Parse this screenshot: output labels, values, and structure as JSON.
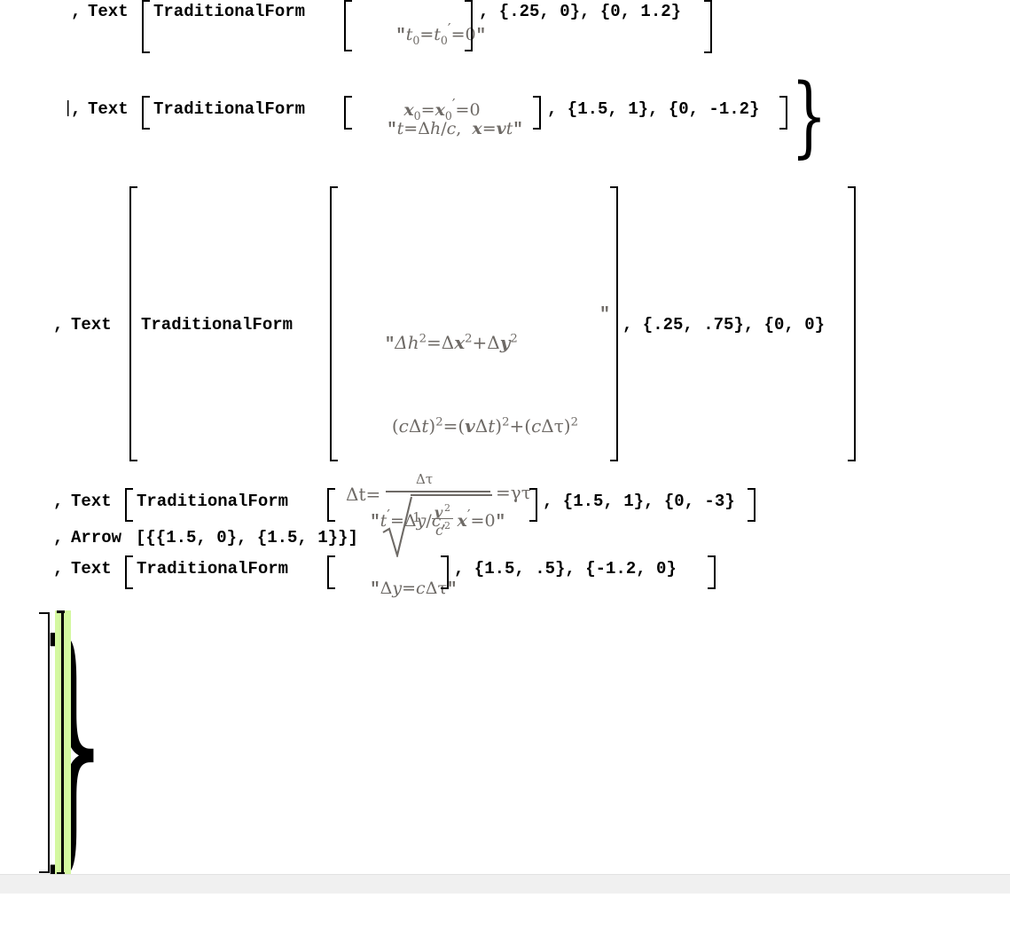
{
  "notebook": {
    "background": "#ffffff",
    "code_color": "#000000",
    "string_color": "#6e6a66",
    "cell_bracket_highlight": "#d4f8a0",
    "chrome_color": "#f0f0f0"
  },
  "line1": {
    "comma": ", ",
    "head": "Text",
    "inner_head": "TraditionalForm",
    "string_line_a_parts": {
      "t": "t",
      "sub0": "0",
      "eq": "=",
      "t2": "t",
      "sub0b": "0",
      "prime": "′",
      "rest": "=0"
    },
    "string_line_b_parts": {
      "x": "x",
      "sub0": "0",
      "eq": "=",
      "x2": "x",
      "sub0b": "0",
      "prime": "′",
      "rest": "=0"
    },
    "coords": ", {.25, 0}, {0, 1.2}"
  },
  "line2": {
    "pipe": "|",
    "comma": ", ",
    "head": "Text",
    "inner_head": "TraditionalForm",
    "string": "\"t=Δh/c,  x=vt\"",
    "string_parts": {
      "a": "t",
      "b": "=Δ",
      "c": "h",
      "d": "/",
      "e": "c",
      "f": ",  ",
      "g": "x",
      "h": "=",
      "i": "v",
      "j": "t"
    },
    "coords": ", {1.5, 1}, {0, -1.2}",
    "close_bracket": "]"
  },
  "line3": {
    "comma": ", ",
    "head": "Text",
    "inner_head": "TraditionalForm",
    "formula": {
      "row1": {
        "dh": "Δh",
        "sup1": "2",
        "eq": "=Δ",
        "x": "x",
        "sup2": "2",
        "plus": "+Δ",
        "y": "y",
        "sup3": "2"
      },
      "row2": {
        "o1": "(",
        "c": "c",
        "d1": "Δ",
        "t1": "t",
        "c1": ")",
        "s1": "2",
        "eq": "=",
        "o2": "(",
        "v": "v",
        "d2": "Δ",
        "t2": "t",
        "c2": ")",
        "s2": "2",
        "plus": "+",
        "o3": "(",
        "c3": "c",
        "d3": "Δ",
        "tau": "τ",
        "c4": ")",
        "s3": "2"
      },
      "row3": {
        "lhs": "Δt=",
        "num": "Δτ",
        "den_one": "1-",
        "den_v": "v",
        "den_vsup": "2",
        "den_c": "c",
        "den_csup": "2",
        "rhs": "=γτ"
      }
    },
    "coords": ", {.25, .75}, {0, 0}"
  },
  "line4": {
    "comma": ", ",
    "head": "Text",
    "inner_head": "TraditionalForm",
    "string_parts": {
      "t": "t",
      "prime": "′",
      "eq": "=Δ",
      "y": "y",
      "slash": "/",
      "c": "c",
      "sep": ",  ",
      "x": "x",
      "xprime": "′",
      "zero": "=0"
    },
    "coords": ", {1.5, 1}, {0, -3}",
    "close_bracket": "]"
  },
  "line5": {
    "comma": ", ",
    "head": "Arrow",
    "args": "[{{1.5, 0}, {1.5, 1}}]"
  },
  "line6": {
    "comma": ", ",
    "head": "Text",
    "inner_head": "TraditionalForm",
    "string_parts": {
      "d": "Δ",
      "y": "y",
      "eq": "=",
      "c": "c",
      "d2": "Δ",
      "tau": "τ"
    },
    "coords": ", {1.5, .5}, {-1.2, 0}",
    "close_bracket": "]"
  },
  "closers": {
    "brace_close": "}",
    "bracket_close": "]"
  }
}
